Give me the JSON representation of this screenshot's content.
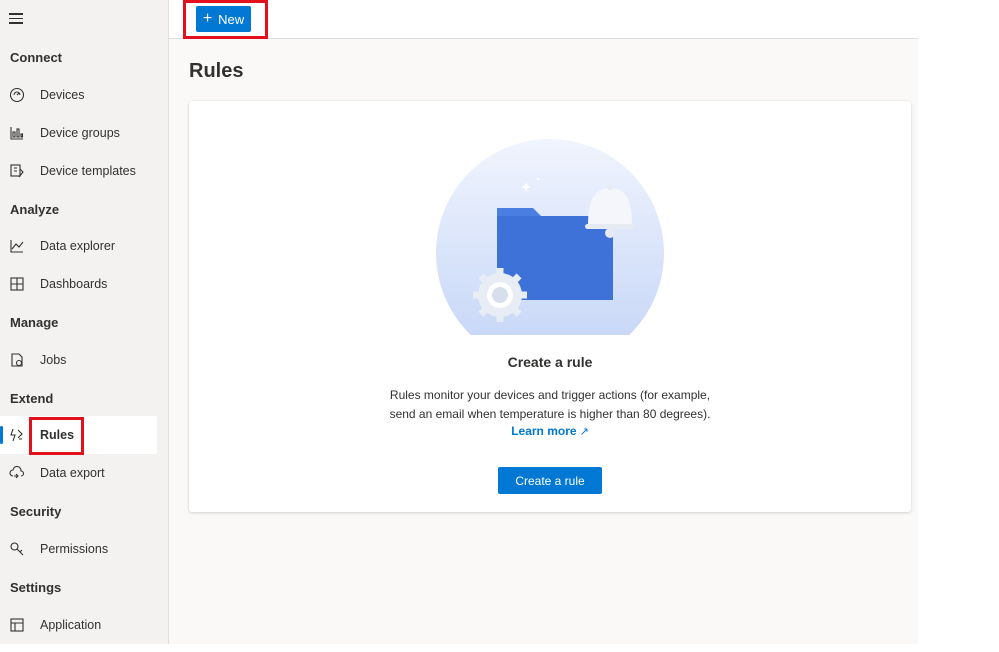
{
  "toolbar": {
    "new_label": "New"
  },
  "sidebar": {
    "sections": [
      {
        "label": "Connect"
      },
      {
        "label": "Analyze"
      },
      {
        "label": "Manage"
      },
      {
        "label": "Extend"
      },
      {
        "label": "Security"
      },
      {
        "label": "Settings"
      }
    ],
    "items": [
      {
        "label": "Devices",
        "icon": "devices-icon"
      },
      {
        "label": "Device groups",
        "icon": "device-groups-icon"
      },
      {
        "label": "Device templates",
        "icon": "device-templates-icon"
      },
      {
        "label": "Data explorer",
        "icon": "data-explorer-icon"
      },
      {
        "label": "Dashboards",
        "icon": "dashboards-icon"
      },
      {
        "label": "Jobs",
        "icon": "jobs-icon"
      },
      {
        "label": "Rules",
        "icon": "rules-icon",
        "active": true
      },
      {
        "label": "Data export",
        "icon": "data-export-icon"
      },
      {
        "label": "Permissions",
        "icon": "permissions-icon"
      },
      {
        "label": "Application",
        "icon": "application-icon"
      }
    ]
  },
  "main": {
    "title": "Rules",
    "empty_state": {
      "heading": "Create a rule",
      "description_line1": "Rules monitor your devices and trigger actions (for example,",
      "description_line2": "send an email when temperature is higher than 80 degrees).",
      "learn_more": "Learn more",
      "button": "Create a rule"
    }
  },
  "colors": {
    "accent": "#0078d4",
    "highlight": "#e3101d",
    "sidebar_bg": "#f3f2f1"
  }
}
